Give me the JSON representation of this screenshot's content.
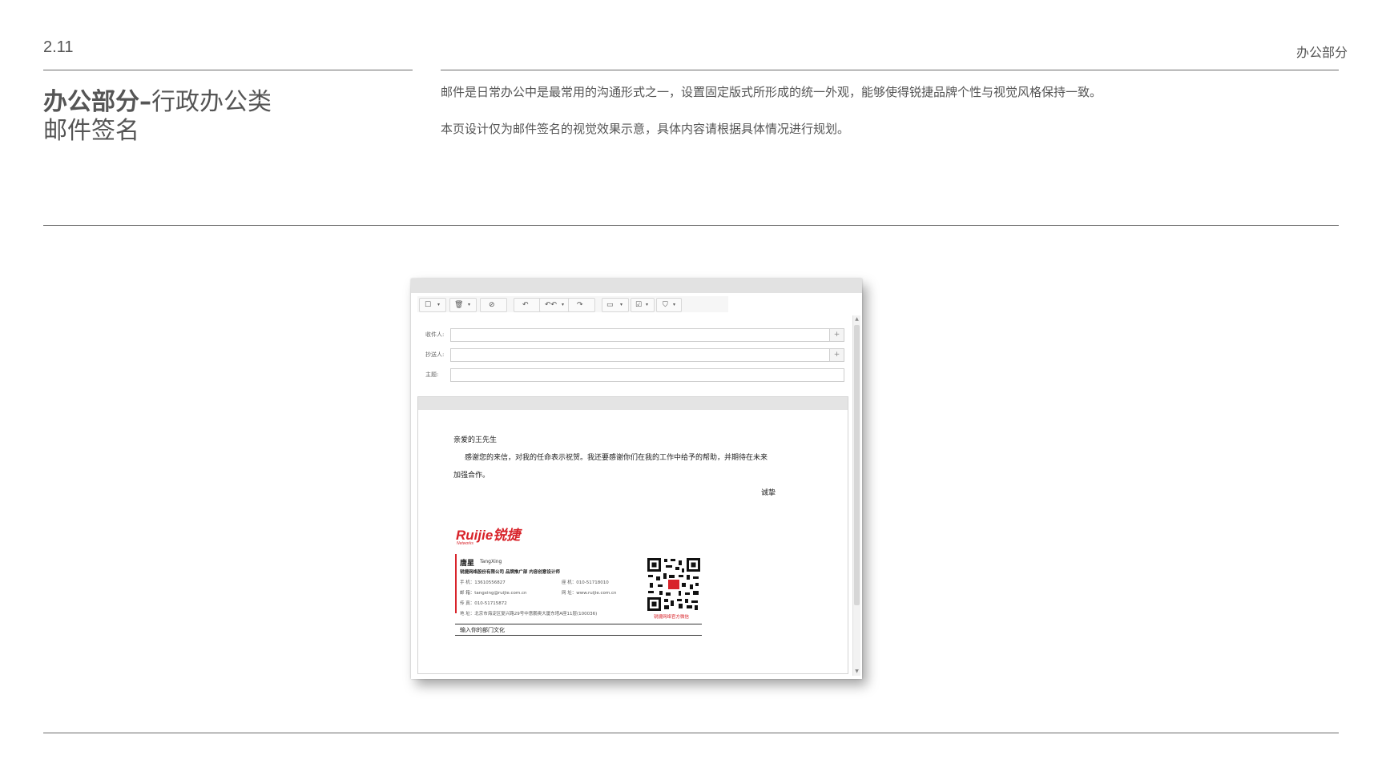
{
  "header": {
    "page_number": "2.11",
    "section": "办公部分"
  },
  "title": {
    "bold_part": "办公部分",
    "dash": "–",
    "rest": "行政办公类",
    "line2": "邮件签名"
  },
  "description": {
    "line1": "邮件是日常办公中是最常用的沟通形式之一，设置固定版式所形成的统一外观，能够使得锐捷品牌个性与视觉风格保持一致。",
    "line2": "本页设计仅为邮件签名的视觉效果示意，具体内容请根据具体情况进行规划。"
  },
  "email": {
    "fields": {
      "to_label": "收件人:",
      "cc_label": "抄送人:",
      "subject_label": "主题:",
      "plus": "+"
    },
    "toolbar_icons": [
      "checkbox-icon",
      "delete-icon",
      "block-icon",
      "reply-icon",
      "reply-all-icon",
      "forward-icon",
      "folder-icon",
      "mark-icon",
      "filter-icon"
    ],
    "body": {
      "greeting": "亲爱的王先生",
      "paragraph_line1": "感谢您的来信，对我的任命表示祝贺。我还要感谢你们在我的工作中给予的帮助，并期待在未来",
      "paragraph_line2": "加强合作。",
      "closing": "诚挚"
    },
    "signature": {
      "logo_text": "Ruijie锐捷",
      "logo_sub": "Networks",
      "name": "唐星",
      "name_en": "TangXing",
      "company_line": "锐捷网络股份有限公司  品牌推广部  内容创意设计师",
      "mobile": "手 机：13610556827",
      "phone": "座 机：010-51718010",
      "email": "邮 箱：tangxing@ruijie.com.cn",
      "website": "网 址：www.ruijie.com.cn",
      "fax": "传 真：010-51715872",
      "address": "地 址：北京市海淀区复兴路29号中意鹏奥大厦东塔A座11层(100036)",
      "qr_caption": "锐捷网络官方微信",
      "dept_culture": "输入你的部门文化"
    },
    "colors": {
      "brand_red": "#d8232a"
    }
  }
}
